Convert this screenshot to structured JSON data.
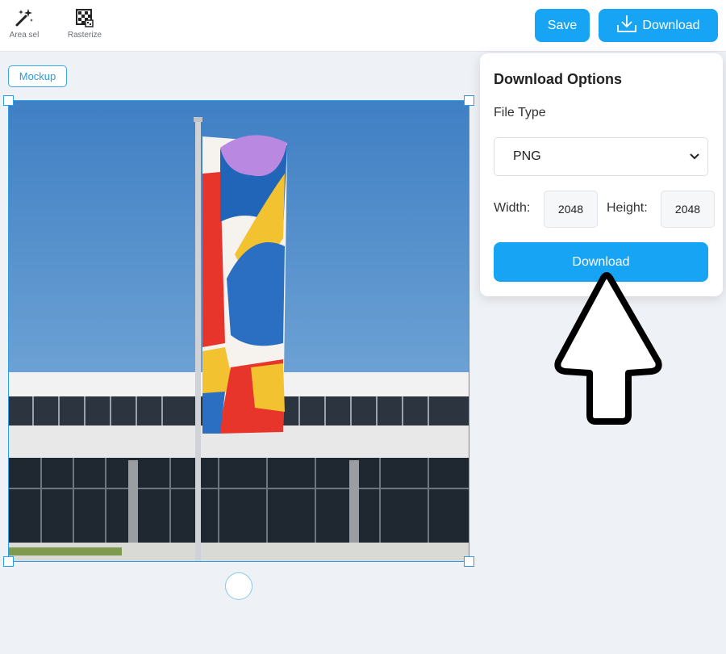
{
  "toolbar": {
    "tools": [
      {
        "label": "Area sel",
        "icon": "magic-wand-icon"
      },
      {
        "label": "Rasterize",
        "icon": "rasterize-grid-icon"
      }
    ],
    "save_label": "Save",
    "download_label": "Download",
    "download_icon": "download-icon"
  },
  "canvas": {
    "tag_label": "Mockup",
    "image_description_icon": "flag-building-photo"
  },
  "download_panel": {
    "title": "Download Options",
    "file_type_label": "File Type",
    "file_type_value": "PNG",
    "width_label": "Width:",
    "width_value": "2048",
    "height_label": "Height:",
    "height_value": "2048",
    "download_button_label": "Download"
  },
  "colors": {
    "accent": "#18a4f5",
    "selection": "#2f9de3",
    "background": "#eef1f5"
  }
}
